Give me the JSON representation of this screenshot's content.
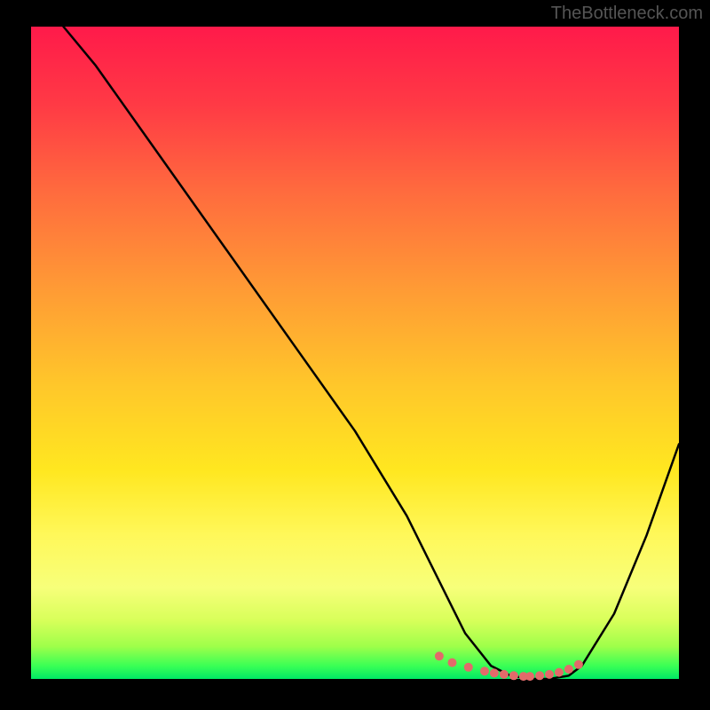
{
  "watermark": "TheBottleneck.com",
  "chart_data": {
    "type": "line",
    "title": "",
    "xlabel": "",
    "ylabel": "",
    "xlim": [
      0,
      100
    ],
    "ylim": [
      0,
      100
    ],
    "series": [
      {
        "name": "curve",
        "x": [
          5,
          10,
          20,
          30,
          40,
          50,
          58,
          63,
          67,
          71,
          74,
          77,
          80,
          83,
          85,
          90,
          95,
          100
        ],
        "values": [
          100,
          94,
          80,
          66,
          52,
          38,
          25,
          15,
          7,
          2,
          0.5,
          0,
          0,
          0.5,
          2,
          10,
          22,
          36
        ]
      }
    ],
    "points": {
      "name": "bottom-markers",
      "x": [
        63,
        65,
        67.5,
        70,
        71.5,
        73,
        74.5,
        76,
        77,
        78.5,
        80,
        81.5,
        83,
        84.5
      ],
      "values": [
        3.5,
        2.5,
        1.8,
        1.2,
        0.9,
        0.7,
        0.5,
        0.4,
        0.4,
        0.5,
        0.7,
        1.0,
        1.5,
        2.2
      ],
      "color": "#e26a6a",
      "radius": 5
    },
    "gradient_stops": [
      {
        "pos": 0,
        "color": "#ff1a4a"
      },
      {
        "pos": 50,
        "color": "#ffc72a"
      },
      {
        "pos": 80,
        "color": "#fff85a"
      },
      {
        "pos": 100,
        "color": "#00e865"
      }
    ]
  }
}
